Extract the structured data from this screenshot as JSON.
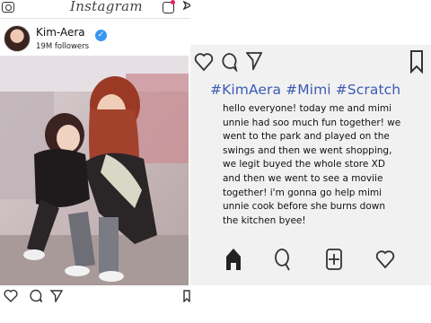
{
  "app": {
    "logo_text": "Instagram"
  },
  "profile": {
    "username": "Kim-Aera",
    "followers": "19M followers",
    "verified_mark": "✓"
  },
  "post": {
    "hashtags": "#KimAera #Mimi #Scratch",
    "caption": "hello everyone! today me and mimi unnie had soo much fun together! we went to the park and played on the swings and then we went shopping, we legit buyed the whole store XD and then we went to see a moviie together! i'm gonna go help mimi unnie cook before she burns down the kitchen byee!"
  },
  "icons": {
    "top_left": "camera-icon",
    "top_right": [
      "activity-icon",
      "send-icon"
    ],
    "post_actions": [
      "heart-icon",
      "comment-icon",
      "share-icon"
    ],
    "right_actions": [
      "heart-icon",
      "comment-icon",
      "share-icon",
      "bookmark-icon"
    ],
    "bottom_nav": [
      "home-icon",
      "search-icon",
      "add-post-icon",
      "heart-icon"
    ]
  },
  "colors": {
    "hashtag": "#3c5ab5",
    "verified": "#3897f0",
    "card_background": "#f1f1f1"
  }
}
